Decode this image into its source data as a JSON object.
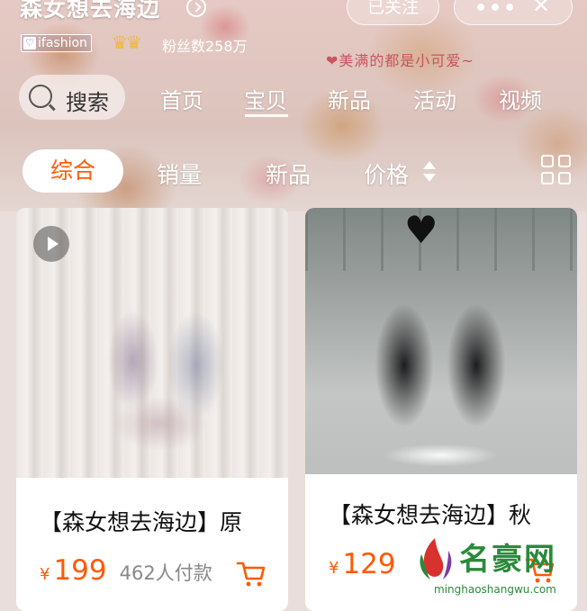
{
  "header": {
    "shop_name": "森女想去海边",
    "follow_label": "已关注",
    "more_label": "•••",
    "close_label": "✕",
    "badge_label": "ifashion",
    "badge_heart": "♡",
    "crowns": "♛♛",
    "fans_text": "粉丝数258万",
    "deco_text": "❤美满的都是小可爱~"
  },
  "nav": {
    "search_label": "搜索",
    "tabs": [
      "首页",
      "宝贝",
      "新品",
      "活动",
      "视频"
    ],
    "active_tab": "宝贝"
  },
  "sort": {
    "items": [
      "综合",
      "销量",
      "新品",
      "价格"
    ],
    "active": "综合"
  },
  "products": [
    {
      "title": "【森女想去海边】原",
      "currency": "¥",
      "price": "199",
      "sold": "462人付款",
      "has_video": true
    },
    {
      "title": "【森女想去海边】秋",
      "currency": "¥",
      "price": "129",
      "sticker": "♥"
    }
  ],
  "watermark": {
    "title": "名豪网",
    "url": "minghaoshangwu.com"
  },
  "colors": {
    "accent": "#ff5a00",
    "watermark": "#2a8a3a"
  },
  "icons": [
    "shop-arrow-icon",
    "search-icon",
    "price-sort-icon",
    "grid-view-icon",
    "play-icon",
    "cart-icon"
  ]
}
